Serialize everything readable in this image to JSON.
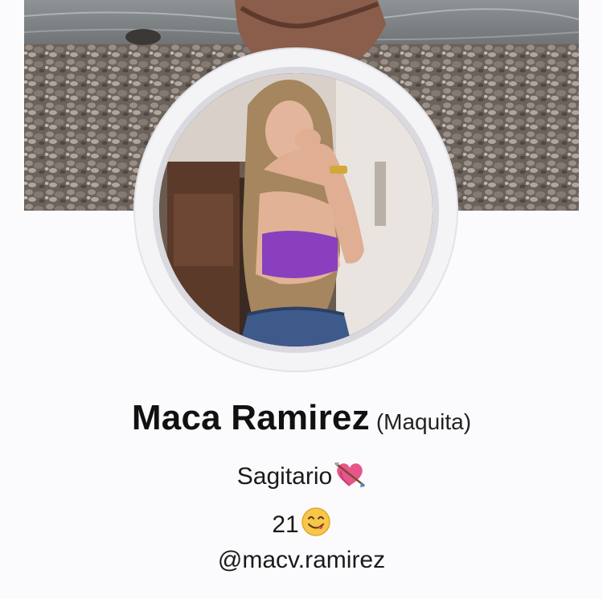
{
  "profile": {
    "display_name": "Maca Ramirez",
    "nickname": "(Maquita)",
    "bio": {
      "line1": "Sagitario",
      "line1_emoji": "heart-with-arrow-icon",
      "line2": "21",
      "line2_emoji": "savoring-face-icon",
      "line3": "@macv.ramirez"
    }
  },
  "colors": {
    "background": "#fbfbfd",
    "text": "#111111",
    "ring": "#d9d9df"
  }
}
